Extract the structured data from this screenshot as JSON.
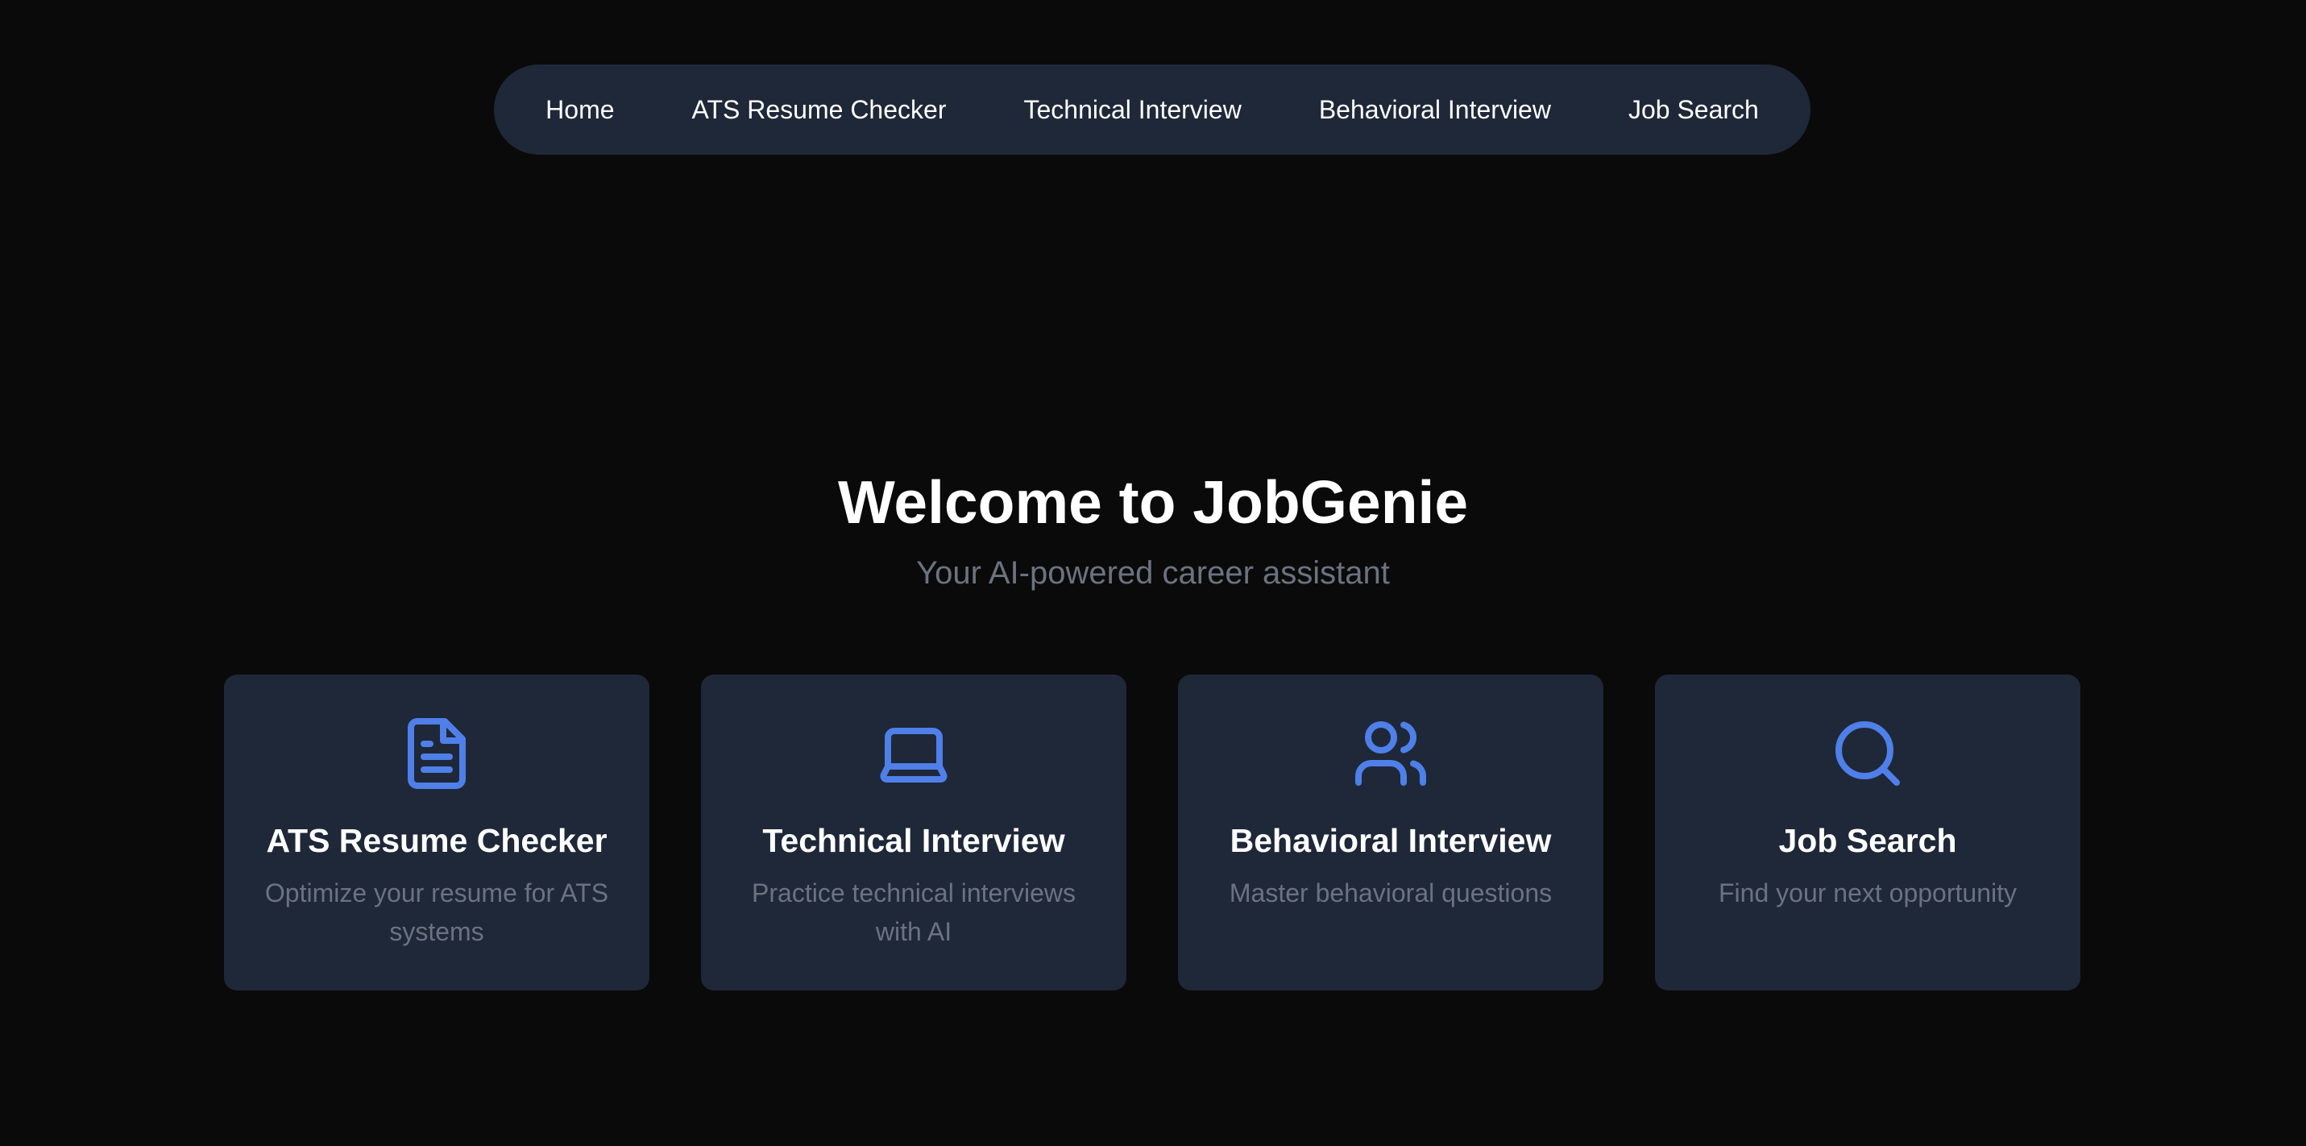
{
  "nav": {
    "items": [
      {
        "label": "Home"
      },
      {
        "label": "ATS Resume Checker"
      },
      {
        "label": "Technical Interview"
      },
      {
        "label": "Behavioral Interview"
      },
      {
        "label": "Job Search"
      }
    ]
  },
  "hero": {
    "title": "Welcome to JobGenie",
    "subtitle": "Your AI-powered career assistant"
  },
  "cards": [
    {
      "title": "ATS Resume Checker",
      "description": "Optimize your resume for ATS systems",
      "icon": "file-text-icon"
    },
    {
      "title": "Technical Interview",
      "description": "Practice technical interviews with AI",
      "icon": "laptop-icon"
    },
    {
      "title": "Behavioral Interview",
      "description": "Master behavioral questions",
      "icon": "users-icon"
    },
    {
      "title": "Job Search",
      "description": "Find your next opportunity",
      "icon": "search-icon"
    }
  ],
  "colors": {
    "background": "#0a0a0a",
    "surface": "#1f2838",
    "accent": "#4f7fe8",
    "text_primary": "#ffffff",
    "text_muted": "#6b7280"
  }
}
